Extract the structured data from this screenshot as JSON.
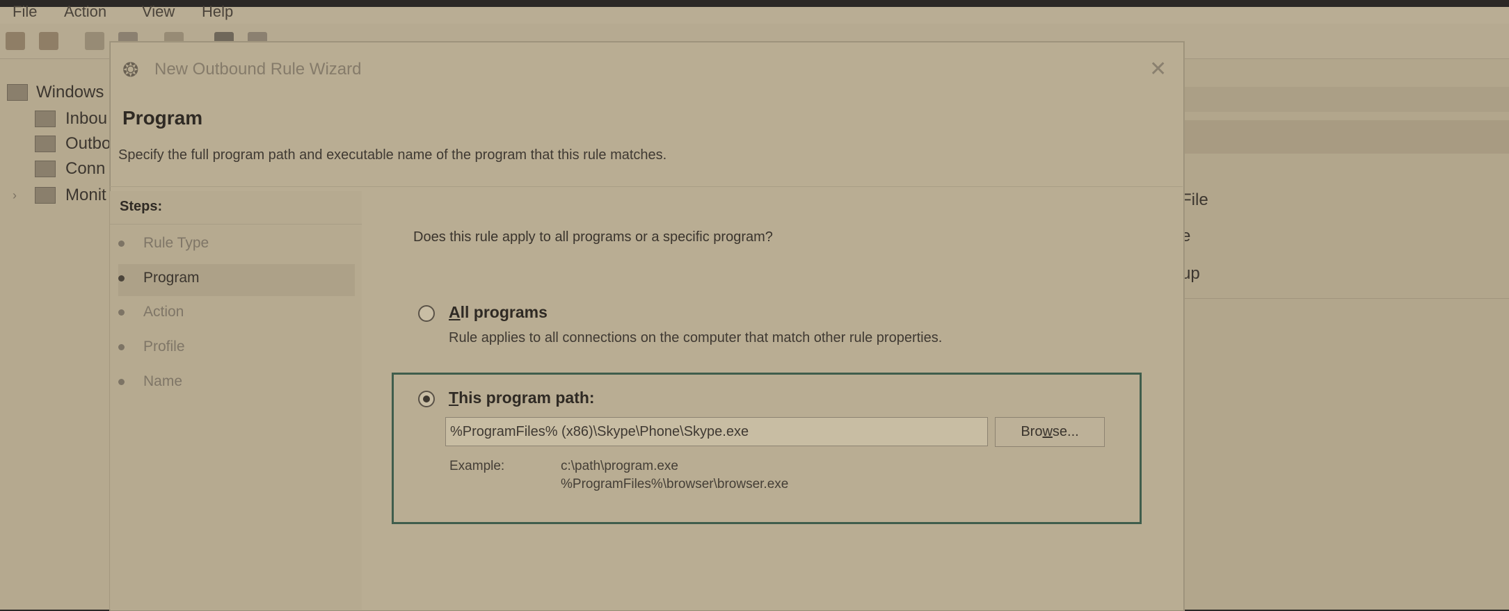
{
  "app": {
    "menu": [
      "File",
      "Action",
      "View",
      "Help"
    ],
    "tree": {
      "root": "Windows",
      "items": [
        "Inbou",
        "Outbo",
        "Conn",
        "Monit"
      ]
    },
    "right_pane_fragments": [
      "File",
      "e",
      "up"
    ]
  },
  "dialog": {
    "title": "New Outbound Rule Wizard",
    "close": "✕",
    "header": {
      "title": "Program",
      "description": "Specify the full program path and executable name of the program that this rule matches."
    },
    "steps": {
      "label": "Steps:",
      "items": [
        "Rule Type",
        "Program",
        "Action",
        "Profile",
        "Name"
      ],
      "active": "Program"
    },
    "question": "Does this rule apply to all programs or a specific program?",
    "options": {
      "all_programs": {
        "accel": "A",
        "label_rest": "ll programs",
        "description": "Rule applies to all connections on the computer that match other rule properties.",
        "checked": false
      },
      "program_path": {
        "accel": "T",
        "label_rest": "his program path:",
        "checked": true,
        "value": "%ProgramFiles% (x86)\\Skype\\Phone\\Skype.exe",
        "browse_accel": "w",
        "browse_pre": "Bro",
        "browse_post": "se...",
        "example_label": "Example:",
        "examples": [
          "c:\\path\\program.exe",
          "%ProgramFiles%\\browser\\browser.exe"
        ]
      }
    }
  },
  "colors": {
    "highlight_border": "#3f5d4c",
    "tint": "#b9ad93"
  }
}
